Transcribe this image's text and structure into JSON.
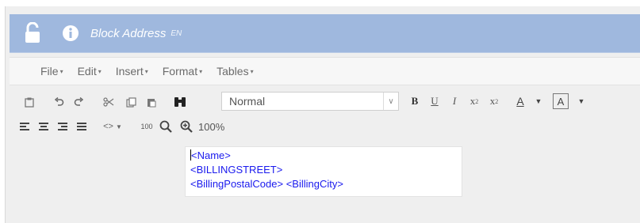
{
  "window": {
    "title": "Block Address",
    "lang": "EN"
  },
  "menu": [
    {
      "label": "File"
    },
    {
      "label": "Edit"
    },
    {
      "label": "Insert"
    },
    {
      "label": "Format"
    },
    {
      "label": "Tables"
    }
  ],
  "toolbar": {
    "style_select_value": "Normal",
    "bold": "B",
    "underline": "U",
    "italic": "I",
    "font_color": "A",
    "background_color": "A",
    "zoom_value": "100%",
    "zoom_reset_label": "100"
  },
  "editor": {
    "lines": [
      "<Name>",
      "<BILLINGSTREET>",
      "<BillingPostalCode> <BillingCity>"
    ]
  },
  "colors": {
    "titlebar": "#9fb8de",
    "editor_text": "#1a1aee"
  }
}
